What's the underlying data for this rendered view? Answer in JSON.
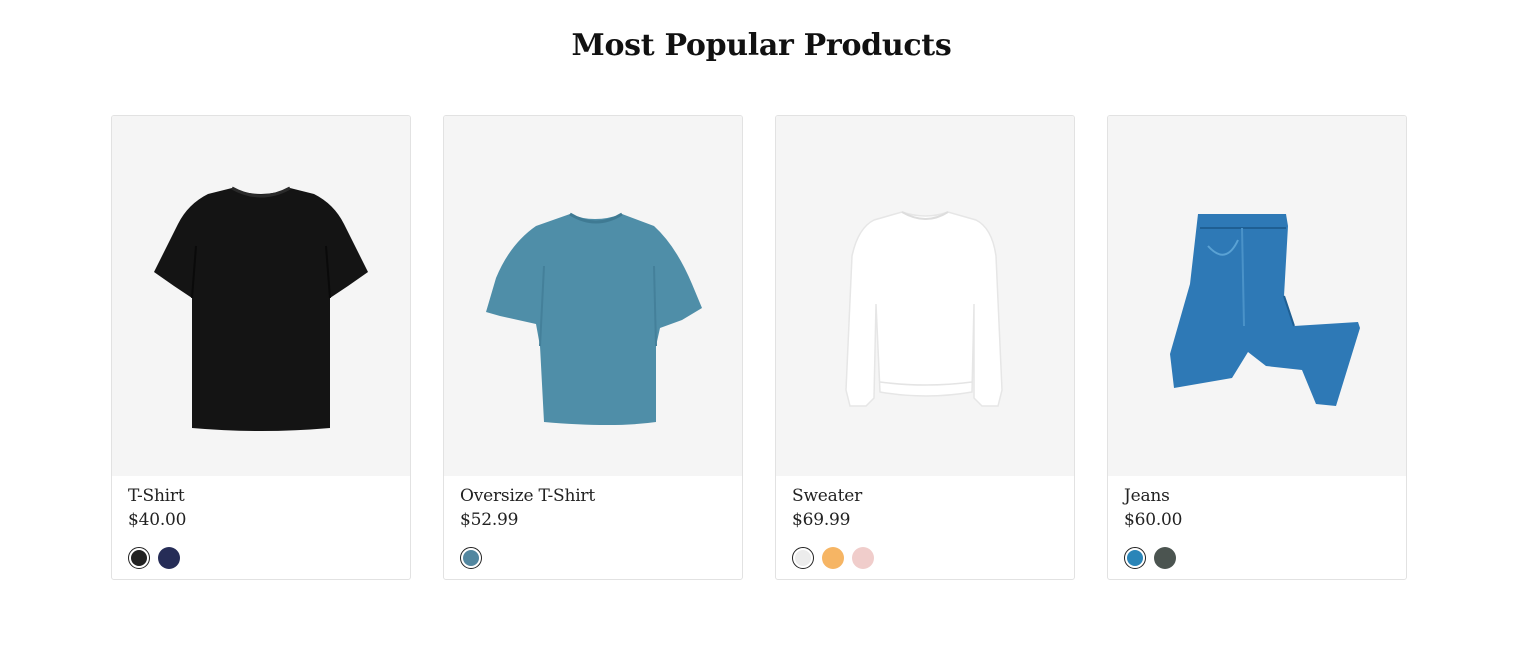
{
  "section": {
    "title": "Most Popular Products"
  },
  "products": [
    {
      "name": "T-Shirt",
      "price": "$40.00",
      "image_icon": "black-tshirt-image",
      "image_color": "#141414",
      "swatches": [
        {
          "color": "#222222",
          "selected": true,
          "light": false
        },
        {
          "color": "#262d57",
          "selected": false,
          "light": false
        }
      ]
    },
    {
      "name": "Oversize T-Shirt",
      "price": "$52.99",
      "image_icon": "teal-oversize-tshirt-image",
      "image_color": "#4f8ea8",
      "swatches": [
        {
          "color": "#5387a0",
          "selected": true,
          "light": false
        }
      ]
    },
    {
      "name": "Sweater",
      "price": "$69.99",
      "image_icon": "white-sweater-image",
      "image_color": "#f4f4f4",
      "swatches": [
        {
          "color": "#ececec",
          "selected": true,
          "light": true
        },
        {
          "color": "#f6b564",
          "selected": false,
          "light": false
        },
        {
          "color": "#f0cdcb",
          "selected": false,
          "light": false
        }
      ]
    },
    {
      "name": "Jeans",
      "price": "$60.00",
      "image_icon": "blue-jeans-image",
      "image_color": "#2e79b6",
      "swatches": [
        {
          "color": "#2a85b8",
          "selected": true,
          "light": false
        },
        {
          "color": "#4b5450",
          "selected": false,
          "light": false
        }
      ]
    }
  ]
}
